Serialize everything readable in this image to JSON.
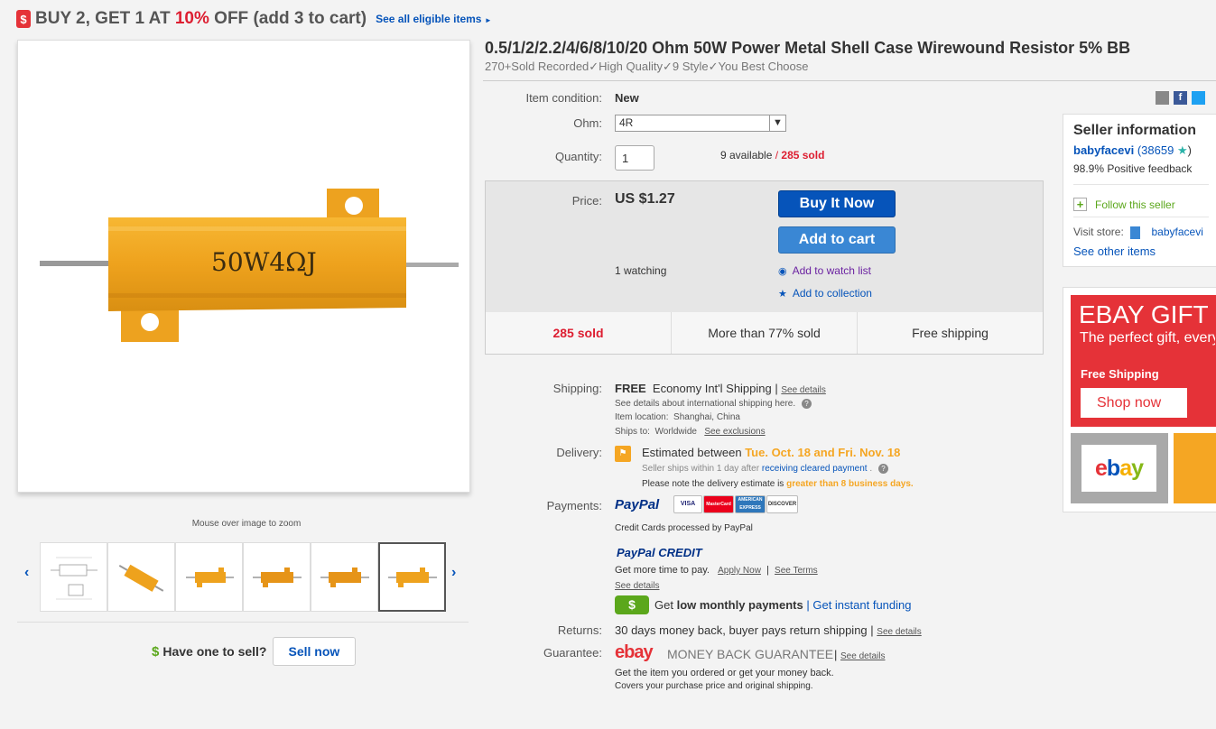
{
  "promo": {
    "tag_icon": "$",
    "text_pre": "BUY 2, GET 1 AT ",
    "text_pct": "10%",
    "text_post": " OFF (add 3 to cart)",
    "link": "See all eligible items",
    "link_arrow": "►"
  },
  "gallery": {
    "main_label": "50W4ΩJ",
    "zoom_hint": "Mouse over image to zoom",
    "prev_arrow": "‹",
    "next_arrow": "›",
    "thumb_count": 6,
    "active_thumb": 6
  },
  "sell": {
    "icon": "$",
    "question": "Have one to sell?",
    "button": "Sell now"
  },
  "listing": {
    "title": "0.5/1/2/2.2/4/6/8/10/20 Ohm 50W Power Metal Shell Case Wirewound Resistor 5% BB",
    "subtitle": "270+Sold Recorded✓High Quality✓9 Style✓You Best Choose"
  },
  "details": {
    "condition_label": "Item condition:",
    "condition_value": "New",
    "ohm_label": "Ohm:",
    "ohm_value": "4R",
    "ohm_arrow": "▼",
    "quantity_label": "Quantity:",
    "quantity_value": "1",
    "available": "9 available",
    "sep": " / ",
    "sold": "285 sold"
  },
  "price": {
    "label": "Price:",
    "value": "US $1.27",
    "watching": "1 watching",
    "buy_now": "Buy It Now",
    "add_to_cart": "Add to cart",
    "watch_list": "Add to watch list",
    "collection": "Add to collection"
  },
  "stats": [
    "285 sold",
    "More than 77% sold",
    "Free shipping"
  ],
  "shipping": {
    "label": "Shipping:",
    "free": "FREE",
    "method": "Economy Int'l Shipping |",
    "see_details": "See details",
    "intl_note": "See details about international shipping here.",
    "location_label": "Item location:",
    "location": "Shanghai, China",
    "ships_label": "Ships to:",
    "ships_to": "Worldwide",
    "exclusions": "See exclusions"
  },
  "delivery": {
    "label": "Delivery:",
    "estimated": "Estimated between",
    "dates": "Tue. Oct. 18 and Fri. Nov. 18",
    "seller_ships": "Seller ships within 1 day after",
    "cleared": "receiving cleared payment",
    "note_pre": "Please note the delivery estimate is",
    "note_highlight": "greater than 8 business days."
  },
  "payments": {
    "label": "Payments:",
    "paypal": "PayPal",
    "cards": [
      "VISA",
      "MasterCard",
      "AMERICAN EXPRESS",
      "DISCOVER"
    ],
    "processed": "Credit Cards processed by PayPal",
    "credit_logo": "PayPal CREDIT",
    "more_time": "Get more time to pay.",
    "apply_now": "Apply Now",
    "see_terms": "See Terms",
    "see_details": "See details",
    "get": "Get",
    "low_monthly": "low monthly payments",
    "instant": "| Get instant funding",
    "bar": "|"
  },
  "returns": {
    "label": "Returns:",
    "text": "30 days money back, buyer pays return shipping |",
    "see_details": "See details"
  },
  "guarantee": {
    "label": "Guarantee:",
    "ebay": "ebay",
    "mbg": "MONEY BACK GUARANTEE",
    "bar": "|",
    "see_details": "See details",
    "line1": "Get the item you ordered or get your money back.",
    "line2": "Covers your purchase price and original shipping."
  },
  "seller": {
    "heading": "Seller information",
    "name": "babyfacevi",
    "score": "(38659",
    "score_close": ")",
    "feedback": "98.9% Positive feedback",
    "follow": "Follow this seller",
    "visit_label": "Visit store:",
    "store": "babyfacevi",
    "other_items": "See other items"
  },
  "ad": {
    "headline": "EBAY GIFT",
    "tagline": "The perfect gift, every",
    "free_shipping": "Free Shipping",
    "shop_now": "Shop now",
    "logo": "ebay"
  },
  "colors": {
    "ebay_blue": "#0654ba",
    "ebay_red": "#e53238",
    "sold_red": "#dd1e31",
    "orange": "#f5a623"
  }
}
